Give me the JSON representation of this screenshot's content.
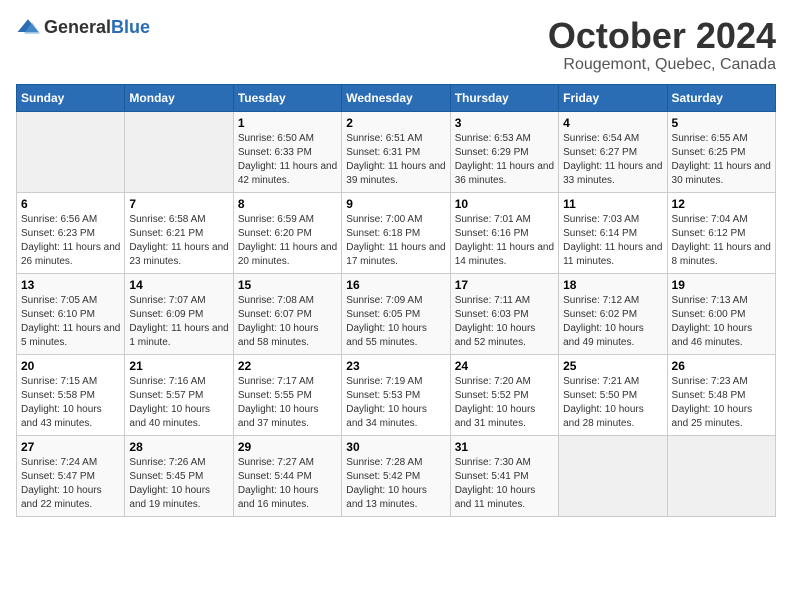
{
  "logo": {
    "text_general": "General",
    "text_blue": "Blue"
  },
  "title": "October 2024",
  "location": "Rougemont, Quebec, Canada",
  "days_of_week": [
    "Sunday",
    "Monday",
    "Tuesday",
    "Wednesday",
    "Thursday",
    "Friday",
    "Saturday"
  ],
  "weeks": [
    [
      {
        "day": "",
        "sunrise": "",
        "sunset": "",
        "daylight": ""
      },
      {
        "day": "",
        "sunrise": "",
        "sunset": "",
        "daylight": ""
      },
      {
        "day": "1",
        "sunrise": "Sunrise: 6:50 AM",
        "sunset": "Sunset: 6:33 PM",
        "daylight": "Daylight: 11 hours and 42 minutes."
      },
      {
        "day": "2",
        "sunrise": "Sunrise: 6:51 AM",
        "sunset": "Sunset: 6:31 PM",
        "daylight": "Daylight: 11 hours and 39 minutes."
      },
      {
        "day": "3",
        "sunrise": "Sunrise: 6:53 AM",
        "sunset": "Sunset: 6:29 PM",
        "daylight": "Daylight: 11 hours and 36 minutes."
      },
      {
        "day": "4",
        "sunrise": "Sunrise: 6:54 AM",
        "sunset": "Sunset: 6:27 PM",
        "daylight": "Daylight: 11 hours and 33 minutes."
      },
      {
        "day": "5",
        "sunrise": "Sunrise: 6:55 AM",
        "sunset": "Sunset: 6:25 PM",
        "daylight": "Daylight: 11 hours and 30 minutes."
      }
    ],
    [
      {
        "day": "6",
        "sunrise": "Sunrise: 6:56 AM",
        "sunset": "Sunset: 6:23 PM",
        "daylight": "Daylight: 11 hours and 26 minutes."
      },
      {
        "day": "7",
        "sunrise": "Sunrise: 6:58 AM",
        "sunset": "Sunset: 6:21 PM",
        "daylight": "Daylight: 11 hours and 23 minutes."
      },
      {
        "day": "8",
        "sunrise": "Sunrise: 6:59 AM",
        "sunset": "Sunset: 6:20 PM",
        "daylight": "Daylight: 11 hours and 20 minutes."
      },
      {
        "day": "9",
        "sunrise": "Sunrise: 7:00 AM",
        "sunset": "Sunset: 6:18 PM",
        "daylight": "Daylight: 11 hours and 17 minutes."
      },
      {
        "day": "10",
        "sunrise": "Sunrise: 7:01 AM",
        "sunset": "Sunset: 6:16 PM",
        "daylight": "Daylight: 11 hours and 14 minutes."
      },
      {
        "day": "11",
        "sunrise": "Sunrise: 7:03 AM",
        "sunset": "Sunset: 6:14 PM",
        "daylight": "Daylight: 11 hours and 11 minutes."
      },
      {
        "day": "12",
        "sunrise": "Sunrise: 7:04 AM",
        "sunset": "Sunset: 6:12 PM",
        "daylight": "Daylight: 11 hours and 8 minutes."
      }
    ],
    [
      {
        "day": "13",
        "sunrise": "Sunrise: 7:05 AM",
        "sunset": "Sunset: 6:10 PM",
        "daylight": "Daylight: 11 hours and 5 minutes."
      },
      {
        "day": "14",
        "sunrise": "Sunrise: 7:07 AM",
        "sunset": "Sunset: 6:09 PM",
        "daylight": "Daylight: 11 hours and 1 minute."
      },
      {
        "day": "15",
        "sunrise": "Sunrise: 7:08 AM",
        "sunset": "Sunset: 6:07 PM",
        "daylight": "Daylight: 10 hours and 58 minutes."
      },
      {
        "day": "16",
        "sunrise": "Sunrise: 7:09 AM",
        "sunset": "Sunset: 6:05 PM",
        "daylight": "Daylight: 10 hours and 55 minutes."
      },
      {
        "day": "17",
        "sunrise": "Sunrise: 7:11 AM",
        "sunset": "Sunset: 6:03 PM",
        "daylight": "Daylight: 10 hours and 52 minutes."
      },
      {
        "day": "18",
        "sunrise": "Sunrise: 7:12 AM",
        "sunset": "Sunset: 6:02 PM",
        "daylight": "Daylight: 10 hours and 49 minutes."
      },
      {
        "day": "19",
        "sunrise": "Sunrise: 7:13 AM",
        "sunset": "Sunset: 6:00 PM",
        "daylight": "Daylight: 10 hours and 46 minutes."
      }
    ],
    [
      {
        "day": "20",
        "sunrise": "Sunrise: 7:15 AM",
        "sunset": "Sunset: 5:58 PM",
        "daylight": "Daylight: 10 hours and 43 minutes."
      },
      {
        "day": "21",
        "sunrise": "Sunrise: 7:16 AM",
        "sunset": "Sunset: 5:57 PM",
        "daylight": "Daylight: 10 hours and 40 minutes."
      },
      {
        "day": "22",
        "sunrise": "Sunrise: 7:17 AM",
        "sunset": "Sunset: 5:55 PM",
        "daylight": "Daylight: 10 hours and 37 minutes."
      },
      {
        "day": "23",
        "sunrise": "Sunrise: 7:19 AM",
        "sunset": "Sunset: 5:53 PM",
        "daylight": "Daylight: 10 hours and 34 minutes."
      },
      {
        "day": "24",
        "sunrise": "Sunrise: 7:20 AM",
        "sunset": "Sunset: 5:52 PM",
        "daylight": "Daylight: 10 hours and 31 minutes."
      },
      {
        "day": "25",
        "sunrise": "Sunrise: 7:21 AM",
        "sunset": "Sunset: 5:50 PM",
        "daylight": "Daylight: 10 hours and 28 minutes."
      },
      {
        "day": "26",
        "sunrise": "Sunrise: 7:23 AM",
        "sunset": "Sunset: 5:48 PM",
        "daylight": "Daylight: 10 hours and 25 minutes."
      }
    ],
    [
      {
        "day": "27",
        "sunrise": "Sunrise: 7:24 AM",
        "sunset": "Sunset: 5:47 PM",
        "daylight": "Daylight: 10 hours and 22 minutes."
      },
      {
        "day": "28",
        "sunrise": "Sunrise: 7:26 AM",
        "sunset": "Sunset: 5:45 PM",
        "daylight": "Daylight: 10 hours and 19 minutes."
      },
      {
        "day": "29",
        "sunrise": "Sunrise: 7:27 AM",
        "sunset": "Sunset: 5:44 PM",
        "daylight": "Daylight: 10 hours and 16 minutes."
      },
      {
        "day": "30",
        "sunrise": "Sunrise: 7:28 AM",
        "sunset": "Sunset: 5:42 PM",
        "daylight": "Daylight: 10 hours and 13 minutes."
      },
      {
        "day": "31",
        "sunrise": "Sunrise: 7:30 AM",
        "sunset": "Sunset: 5:41 PM",
        "daylight": "Daylight: 10 hours and 11 minutes."
      },
      {
        "day": "",
        "sunrise": "",
        "sunset": "",
        "daylight": ""
      },
      {
        "day": "",
        "sunrise": "",
        "sunset": "",
        "daylight": ""
      }
    ]
  ]
}
